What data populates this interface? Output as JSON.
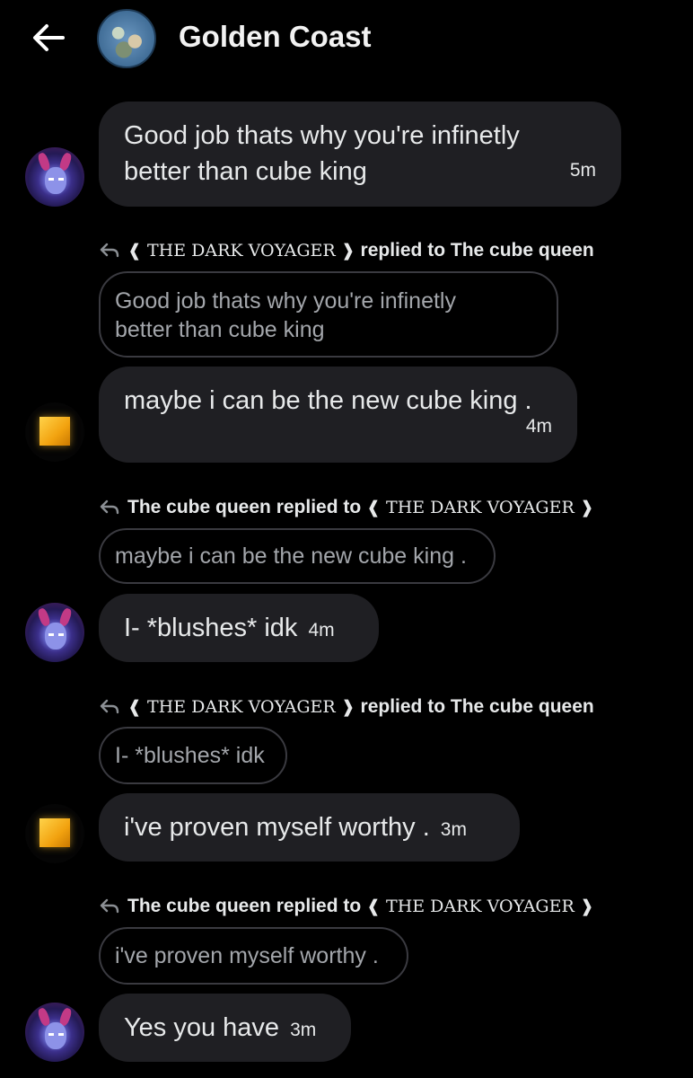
{
  "header": {
    "title": "Golden Coast",
    "back_icon": "arrow-left-icon"
  },
  "messages": [
    {
      "type": "message",
      "sender": "The cube queen",
      "text_line1": "Good job thats why you're infinetly",
      "text_line2": "better than cube king",
      "time": "5m"
    },
    {
      "type": "reply",
      "replier": "❰ THE DARK VOYAGER ❱",
      "replied_to_label": "replied to",
      "target": "The cube queen",
      "quoted_line1": "Good job thats why you're infinetly",
      "quoted_line2": "better than cube king"
    },
    {
      "type": "message",
      "sender": "❰ THE DARK VOYAGER ❱",
      "text": "maybe i can be the new cube king .",
      "time": "4m"
    },
    {
      "type": "reply",
      "replier": "The cube queen",
      "replied_to_label": "replied to",
      "target": "❰ THE DARK VOYAGER ❱",
      "quoted": "maybe i can be the new cube king ."
    },
    {
      "type": "message",
      "sender": "The cube queen",
      "text": "I- *blushes* idk",
      "time": "4m"
    },
    {
      "type": "reply",
      "replier": "❰ THE DARK VOYAGER ❱",
      "replied_to_label": "replied to",
      "target": "The cube queen",
      "quoted": "I- *blushes* idk"
    },
    {
      "type": "message",
      "sender": "❰ THE DARK VOYAGER ❱",
      "text": "i've proven myself worthy .",
      "time": "3m"
    },
    {
      "type": "reply",
      "replier": "The cube queen",
      "replied_to_label": "replied to",
      "target": "❰ THE DARK VOYAGER ❱",
      "quoted": "i've proven myself worthy ."
    },
    {
      "type": "message",
      "sender": "The cube queen",
      "text": "Yes you have",
      "time": "3m"
    }
  ],
  "colors": {
    "background": "#000000",
    "bubble": "#1f1f23",
    "quote_border": "#3a3a40",
    "quote_text": "#a3a6ab"
  }
}
